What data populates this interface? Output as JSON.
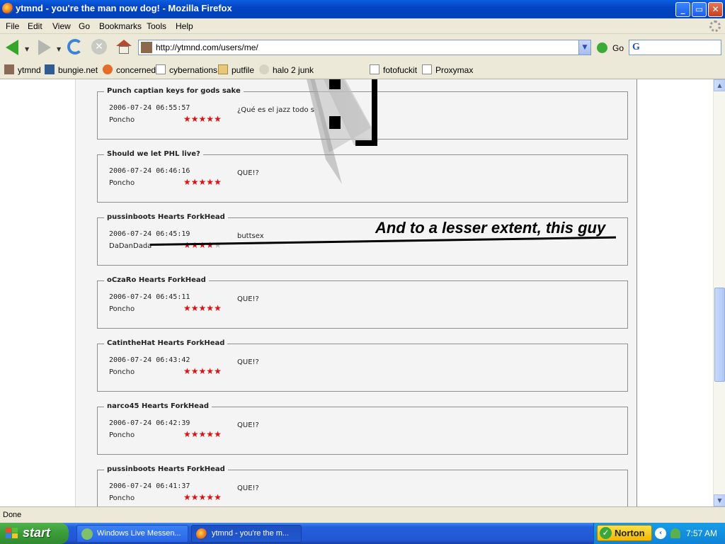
{
  "window": {
    "title": "ytmnd - you're the man now dog! - Mozilla Firefox",
    "buttons": {
      "minimize": "_",
      "maximize": "▭",
      "close": "✕"
    }
  },
  "menu": [
    "File",
    "Edit",
    "View",
    "Go",
    "Bookmarks",
    "Tools",
    "Help"
  ],
  "nav": {
    "url": "http://ytmnd.com/users/me/",
    "go_label": "Go",
    "search_engine_glyph": "G"
  },
  "bookmarks": [
    {
      "label": "ytmnd",
      "icon": "avatar-icon"
    },
    {
      "label": "bungie.net",
      "icon": "bungie-icon"
    },
    {
      "label": "concerned",
      "icon": "concerned-icon"
    },
    {
      "label": "cybernations",
      "icon": "page-icon"
    },
    {
      "label": "putfile",
      "icon": "putfile-icon"
    },
    {
      "label": "halo 2 junk",
      "icon": "eye-icon"
    },
    {
      "label": "fotofuckit",
      "icon": "page-icon"
    },
    {
      "label": "Proxymax",
      "icon": "page-icon"
    }
  ],
  "entries": [
    {
      "title": "Punch captian keys for gods sake",
      "timestamp": "2006-07-24 06:55:57",
      "user": "Poncho",
      "rating": 5,
      "comment": "¿Qué es el jazz todo s"
    },
    {
      "title": "Should we let PHL live?",
      "timestamp": "2006-07-24 06:46:16",
      "user": "Poncho",
      "rating": 5,
      "comment": "QUE!?"
    },
    {
      "title": "pussinboots Hearts ForkHead",
      "timestamp": "2006-07-24 06:45:19",
      "user": "DaDanDada",
      "rating": 4,
      "comment": "buttsex"
    },
    {
      "title": "oCzaRo Hearts ForkHead",
      "timestamp": "2006-07-24 06:45:11",
      "user": "Poncho",
      "rating": 5,
      "comment": "QUE!?"
    },
    {
      "title": "CatintheHat Hearts ForkHead",
      "timestamp": "2006-07-24 06:43:42",
      "user": "Poncho",
      "rating": 5,
      "comment": "QUE!?"
    },
    {
      "title": "narco45 Hearts ForkHead",
      "timestamp": "2006-07-24 06:42:39",
      "user": "Poncho",
      "rating": 5,
      "comment": "QUE!?"
    },
    {
      "title": "pussinboots Hearts ForkHead",
      "timestamp": "2006-07-24 06:41:37",
      "user": "Poncho",
      "rating": 5,
      "comment": "QUE!?"
    }
  ],
  "annotation": "And to a lesser extent, this guy",
  "status": "Done",
  "taskbar": {
    "start_label": "start",
    "tasks": [
      {
        "label": "Windows Live Messen...",
        "icon": "messenger-icon"
      },
      {
        "label": "ytmnd - you're the m...",
        "icon": "firefox-icon"
      }
    ],
    "norton_label": "Norton",
    "clock": "7:57 AM"
  },
  "colors": {
    "title_bar": "#0443c3",
    "chrome": "#ece9d8",
    "page_bg": "#f4f4f4",
    "star_on": "#dd1111",
    "star_off": "#bbbbbb",
    "taskbar": "#245edb",
    "start_button": "#3a9c37"
  }
}
